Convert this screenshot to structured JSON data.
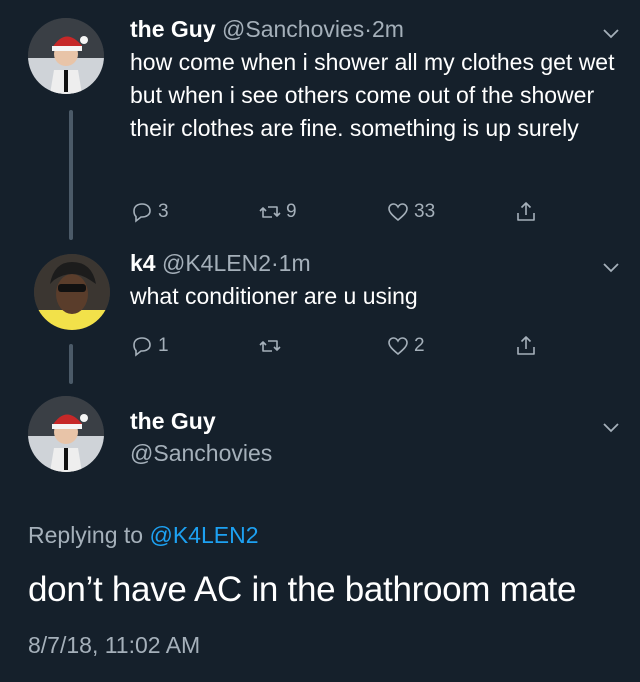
{
  "tweets": [
    {
      "name": "the Guy",
      "handle": "@Sanchovies",
      "dot": "·",
      "time": "2m",
      "text": "how come when i shower all my clothes get wet but when i see others come out of the shower their clothes are fine. something is up surely",
      "replies": "3",
      "retweets": "9",
      "likes": "33"
    },
    {
      "name": "k4",
      "handle": "@K4LEN2",
      "dot": "·",
      "time": "1m",
      "text": "what conditioner are u using",
      "replies": "1",
      "retweets": "",
      "likes": "2"
    }
  ],
  "main": {
    "name": "the Guy",
    "handle": "@Sanchovies",
    "replying_prefix": "Replying to ",
    "replying_to": "@K4LEN2",
    "text": "don’t have AC in the bathroom mate",
    "timestamp": "8/7/18, 11:02 AM"
  },
  "icons": {
    "reply": "reply-icon",
    "retweet": "retweet-icon",
    "like": "heart-icon",
    "share": "share-icon",
    "more": "chevron-down-icon"
  },
  "colors": {
    "background": "#15202b",
    "secondary_text": "#a5b0ba",
    "link": "#1da1f2",
    "thread_line": "#4b5a68"
  }
}
